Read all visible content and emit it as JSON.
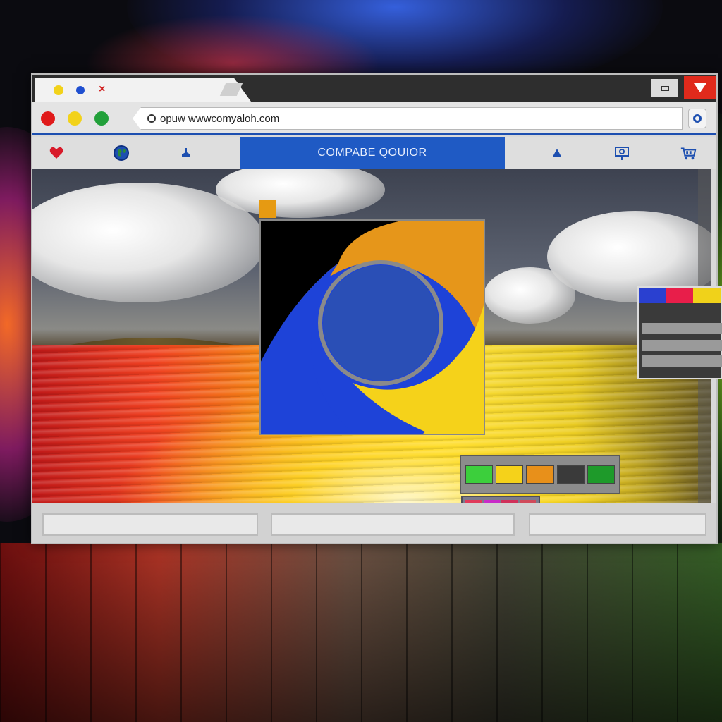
{
  "address_bar": {
    "url": "opuw wwwcomyaloh.com"
  },
  "nav": {
    "title": "COMPABE QOUIOR"
  },
  "tab": {
    "dots": [
      "#f2d21a",
      "#1f4fd0"
    ],
    "close_glyph": "×"
  },
  "traffic_lights": [
    "#e01a1a",
    "#f2d21a",
    "#22a03a"
  ],
  "nav_icons": [
    "heart-icon",
    "globe-icon",
    "bucket-icon",
    "drop-icon",
    "signpost-icon",
    "cart-icon"
  ],
  "swatches": [
    "#3ccf3c",
    "#f5d21a",
    "#e8901a",
    "#3a3a3a",
    "#1e9a2a"
  ],
  "mini_palette": [
    "#e03a5a",
    "#c82ac8",
    "#d0305a",
    "#d04a5a",
    "#6a5ad0",
    "#9a6ad8",
    "#2a62d8",
    "#c25a8a"
  ],
  "side_panel_top": [
    "#2a40d0",
    "#e81e4a",
    "#f0d21a"
  ],
  "colors": {
    "accent_blue": "#1f5ac4",
    "close_red": "#e02a1c",
    "logo_black": "#000000",
    "logo_orange": "#e6961a",
    "logo_yellow": "#f5d21a",
    "logo_blue": "#1e43d8",
    "logo_center": "#2a4fb6"
  }
}
